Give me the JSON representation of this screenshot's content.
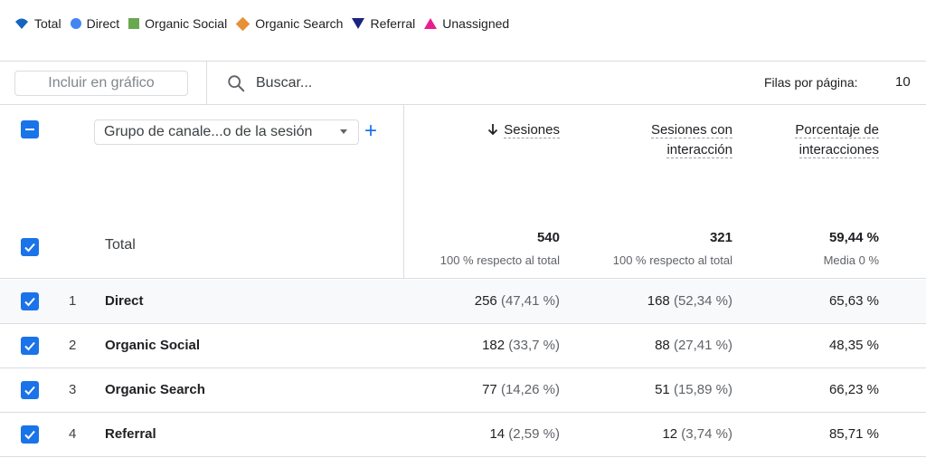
{
  "legend": [
    {
      "label": "Total",
      "shape": "total",
      "color": "#1565c0"
    },
    {
      "label": "Direct",
      "shape": "circle",
      "color": "#4285f4"
    },
    {
      "label": "Organic Social",
      "shape": "square",
      "color": "#6aa84f"
    },
    {
      "label": "Organic Search",
      "shape": "diamond",
      "color": "#e69138"
    },
    {
      "label": "Referral",
      "shape": "triangle-down",
      "color": "#1a237e"
    },
    {
      "label": "Unassigned",
      "shape": "triangle-up",
      "color": "#e91e8c"
    }
  ],
  "toolbar": {
    "include_label": "Incluir en gráfico",
    "search_placeholder": "Buscar...",
    "rows_per_page_label": "Filas por página:",
    "rows_per_page_value": "10"
  },
  "table": {
    "dimension_label": "Grupo de canale...o de la sesión",
    "metrics": [
      {
        "label": "Sesiones",
        "sorted": true
      },
      {
        "label": "Sesiones con interacción",
        "line1": "Sesiones con",
        "line2": "interacción"
      },
      {
        "label": "Porcentaje de interacciones",
        "line1": "Porcentaje de",
        "line2": "interacciones"
      }
    ],
    "total": {
      "label": "Total",
      "sessions": "540",
      "sessions_sub": "100 % respecto al total",
      "engaged": "321",
      "engaged_sub": "100 % respecto al total",
      "rate": "59,44 %",
      "rate_sub": "Media 0 %"
    },
    "rows": [
      {
        "rank": "1",
        "channel": "Direct",
        "sessions": "256",
        "sessions_pct": "(47,41 %)",
        "engaged": "168",
        "engaged_pct": "(52,34 %)",
        "rate": "65,63 %"
      },
      {
        "rank": "2",
        "channel": "Organic Social",
        "sessions": "182",
        "sessions_pct": "(33,7 %)",
        "engaged": "88",
        "engaged_pct": "(27,41 %)",
        "rate": "48,35 %"
      },
      {
        "rank": "3",
        "channel": "Organic Search",
        "sessions": "77",
        "sessions_pct": "(14,26 %)",
        "engaged": "51",
        "engaged_pct": "(15,89 %)",
        "rate": "66,23 %"
      },
      {
        "rank": "4",
        "channel": "Referral",
        "sessions": "14",
        "sessions_pct": "(2,59 %)",
        "engaged": "12",
        "engaged_pct": "(3,74 %)",
        "rate": "85,71 %"
      }
    ]
  },
  "colors": {
    "accent": "#1a73e8",
    "divider": "#dadce0"
  }
}
